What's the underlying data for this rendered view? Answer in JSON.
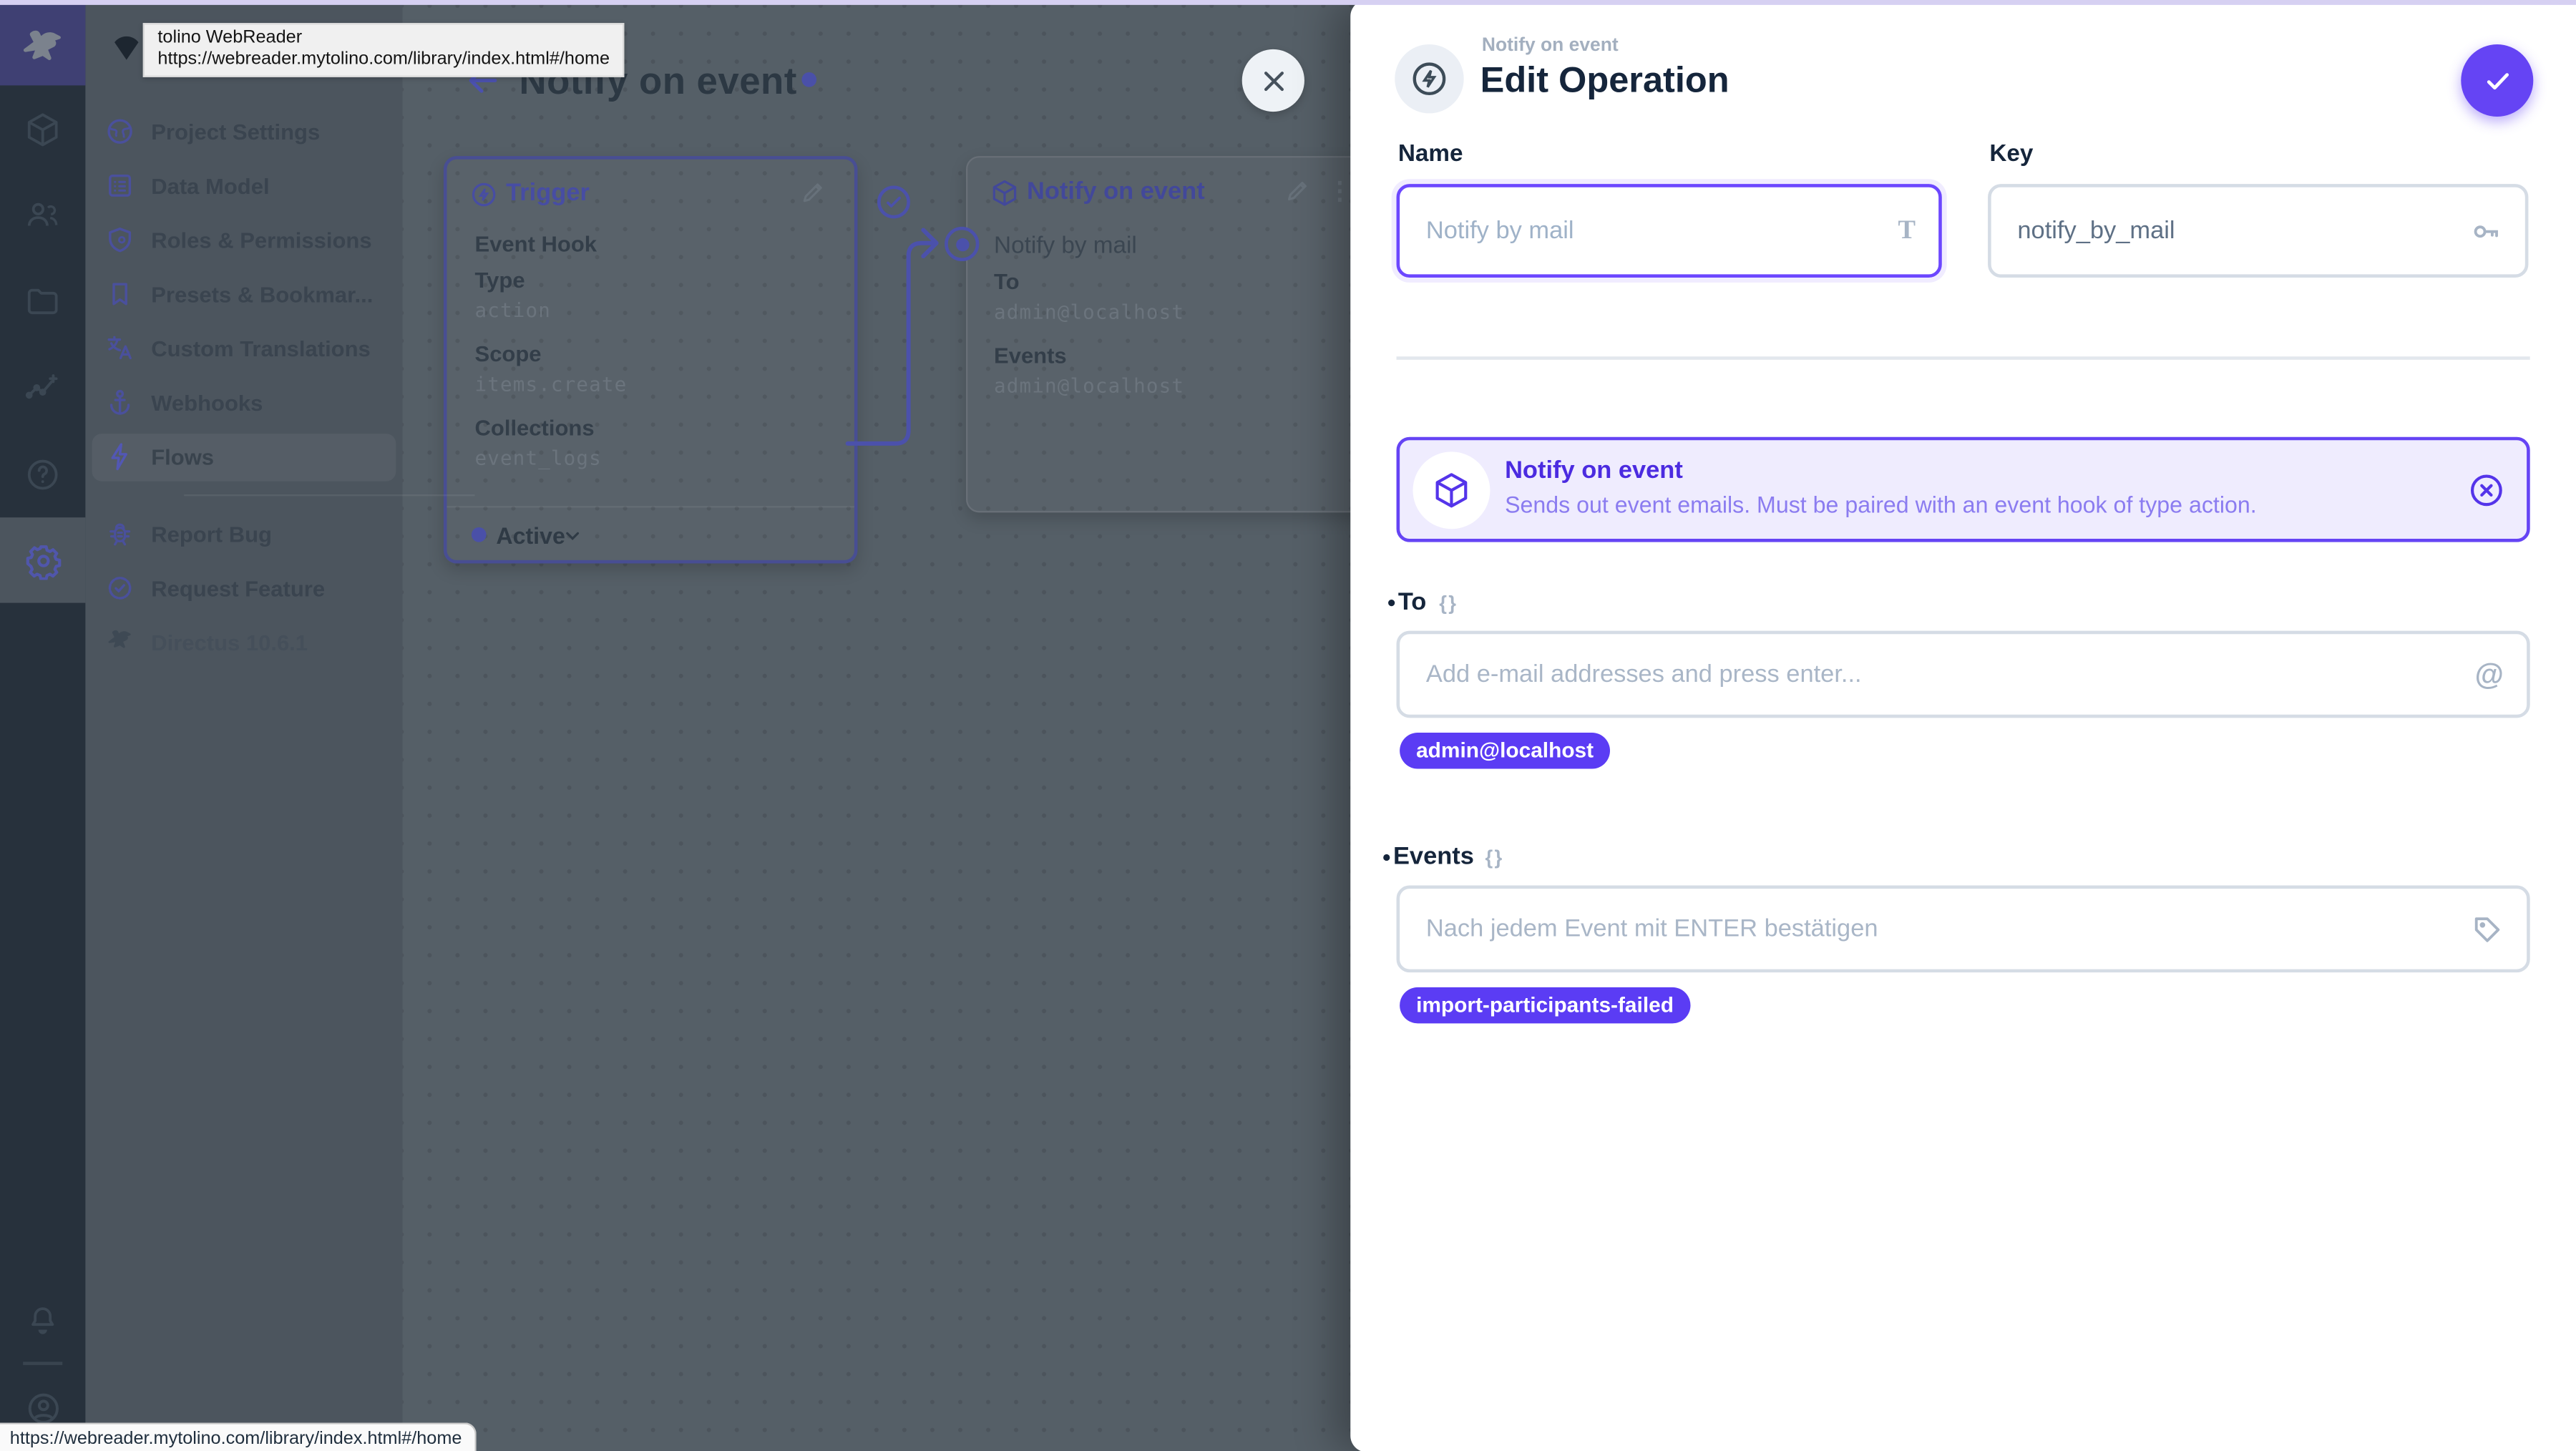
{
  "browser": {
    "tooltip": {
      "title": "tolino WebReader",
      "url": "https://webreader.mytolino.com/library/index.html#/home"
    },
    "status_url": "https://webreader.mytolino.com/library/index.html#/home"
  },
  "module_bar": {
    "logo_icon": "directus-rabbit-icon",
    "icons": [
      "cube-icon",
      "users-icon",
      "folder-icon",
      "insights-icon",
      "help-icon",
      "settings-gear-icon",
      "notifications-bell-icon",
      "user-avatar-icon"
    ],
    "active_module": "settings"
  },
  "nav": {
    "items": [
      {
        "label": "Project Settings",
        "icon": "globe-icon"
      },
      {
        "label": "Data Model",
        "icon": "list-icon"
      },
      {
        "label": "Roles & Permissions",
        "icon": "shield-icon"
      },
      {
        "label": "Presets & Bookmar...",
        "icon": "bookmark-icon"
      },
      {
        "label": "Custom Translations",
        "icon": "translate-icon"
      },
      {
        "label": "Webhooks",
        "icon": "anchor-icon"
      },
      {
        "label": "Flows",
        "icon": "bolt-icon",
        "active": true
      }
    ],
    "footer_items": [
      {
        "label": "Report Bug",
        "icon": "bug-icon"
      },
      {
        "label": "Request Feature",
        "icon": "badge-check-icon"
      }
    ],
    "version": "Directus 10.6.1"
  },
  "flow": {
    "title": "Notify on event",
    "status_color": "#4a50a8",
    "trigger_card": {
      "title": "Trigger",
      "subtitle": "Event Hook",
      "fields": [
        {
          "label": "Type",
          "value": "action"
        },
        {
          "label": "Scope",
          "value": "items.create"
        },
        {
          "label": "Collections",
          "value": "event_logs"
        }
      ],
      "status": "Active"
    },
    "operation_card": {
      "title": "Notify on event",
      "name": "Notify by mail",
      "fields": [
        {
          "label": "To",
          "value": "admin@localhost"
        },
        {
          "label": "Events",
          "value": "admin@localhost"
        }
      ]
    }
  },
  "drawer": {
    "breadcrumb": "Notify on event",
    "title": "Edit Operation",
    "accent_color": "#6544f4",
    "name_field": {
      "label": "Name",
      "value": "Notify by mail"
    },
    "key_field": {
      "label": "Key",
      "value": "notify_by_mail"
    },
    "operation_panel": {
      "title": "Notify on event",
      "description": "Sends out event emails. Must be paired with an event hook of type action."
    },
    "to_field": {
      "label": "To",
      "placeholder": "Add e-mail addresses and press enter...",
      "chips": [
        "admin@localhost"
      ]
    },
    "events_field": {
      "label": "Events",
      "placeholder": "Nach jedem Event mit ENTER bestätigen",
      "chips": [
        "import-participants-failed"
      ]
    }
  }
}
